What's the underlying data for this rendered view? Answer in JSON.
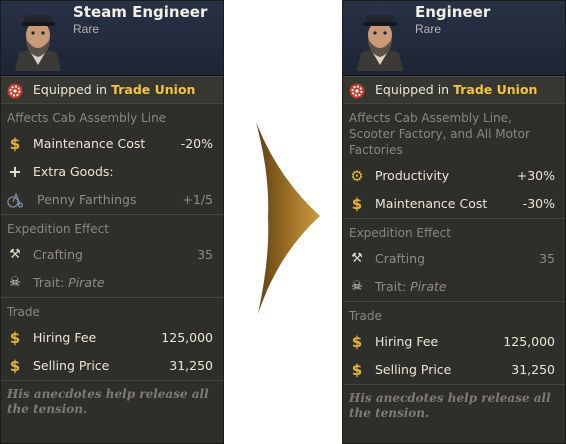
{
  "left": {
    "name": "Steam Engineer",
    "rarity": "Rare",
    "equipped_prefix": "Equipped in",
    "equipped_place": "Trade Union",
    "affects": "Affects Cab Assembly Line",
    "maintenance_label": "Maintenance Cost",
    "maintenance_value": "-20%",
    "extra_goods_label": "Extra Goods:",
    "penny_label": "Penny Farthings",
    "penny_value": "+1/5",
    "expedition_header": "Expedition Effect",
    "crafting_label": "Crafting",
    "crafting_value": "35",
    "trait_label": "Trait:",
    "trait_value": "Pirate",
    "trade_header": "Trade",
    "hiring_label": "Hiring Fee",
    "hiring_value": "125,000",
    "selling_label": "Selling Price",
    "selling_value": "31,250",
    "flavor": "His anecdotes help release all the tension."
  },
  "right": {
    "name": "Engineer",
    "rarity": "Rare",
    "equipped_prefix": "Equipped in",
    "equipped_place": "Trade Union",
    "affects": "Affects Cab Assembly Line, Scooter Factory, and All Motor Factories",
    "productivity_label": "Productivity",
    "productivity_value": "+30%",
    "maintenance_label": "Maintenance Cost",
    "maintenance_value": "-30%",
    "expedition_header": "Expedition Effect",
    "crafting_label": "Crafting",
    "crafting_value": "35",
    "trait_label": "Trait:",
    "trait_value": "Pirate",
    "trade_header": "Trade",
    "hiring_label": "Hiring Fee",
    "hiring_value": "125,000",
    "selling_label": "Selling Price",
    "selling_value": "31,250",
    "flavor": "His anecdotes help release all the tension."
  },
  "icons": {
    "equipped": "gear-badge-icon",
    "maintenance": "dollar-icon",
    "extra_goods": "plus-icon",
    "penny": "bicycle-icon",
    "crafting": "hammer-icon",
    "trait": "skull-icon",
    "productivity": "gear-icon",
    "arrow": "arrow-right-icon"
  },
  "colors": {
    "card_bg": "#2e2f2a",
    "header_bg": "#283246",
    "highlight": "#f5c542",
    "arrow": "#b07f2c"
  }
}
